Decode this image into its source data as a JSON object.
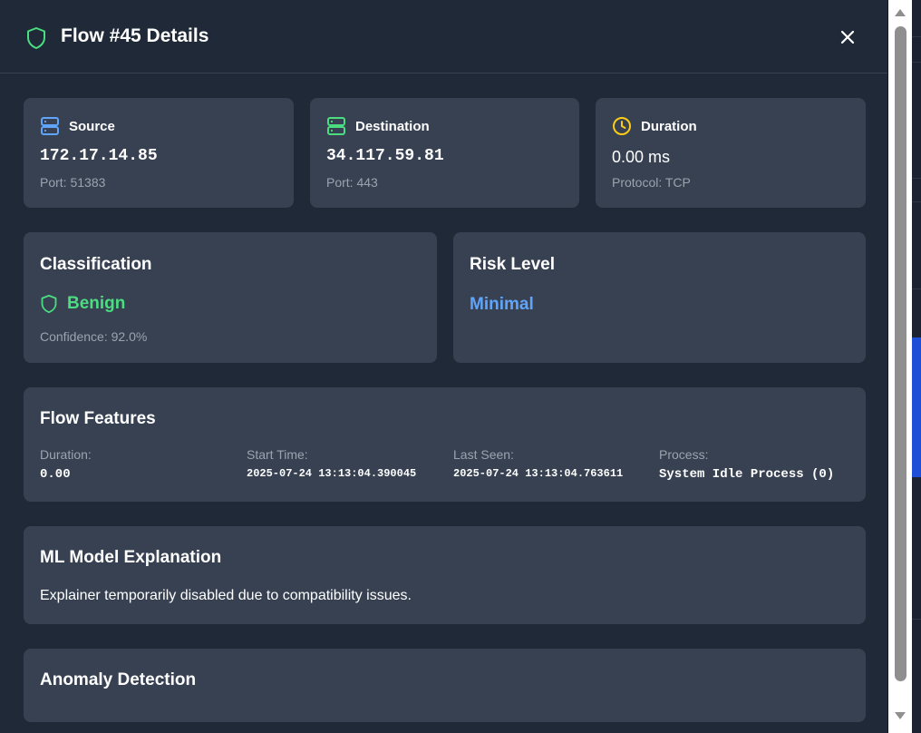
{
  "modal": {
    "title": "Flow #45 Details",
    "close_label": "×"
  },
  "source": {
    "label": "Source",
    "ip": "172.17.14.85",
    "port": "Port: 51383"
  },
  "destination": {
    "label": "Destination",
    "ip": "34.117.59.81",
    "port": "Port: 443"
  },
  "duration": {
    "label": "Duration",
    "value": "0.00 ms",
    "protocol": "Protocol: TCP"
  },
  "classification": {
    "title": "Classification",
    "value": "Benign",
    "confidence": "Confidence: 92.0%"
  },
  "risk": {
    "title": "Risk Level",
    "value": "Minimal"
  },
  "features": {
    "title": "Flow Features",
    "items": [
      {
        "label": "Duration:",
        "value": "0.00"
      },
      {
        "label": "Start Time:",
        "value": "2025-07-24 13:13:04.390045"
      },
      {
        "label": "Last Seen:",
        "value": "2025-07-24 13:13:04.763611"
      },
      {
        "label": "Process:",
        "value": "System Idle Process (0)"
      }
    ]
  },
  "ml": {
    "title": "ML Model Explanation",
    "text": "Explainer temporarily disabled due to compatibility issues."
  },
  "anomaly": {
    "title": "Anomaly Detection"
  },
  "colors": {
    "benign": "#4ade80",
    "risk_minimal": "#60a5fa",
    "duration_icon": "#facc15",
    "source_icon": "#60a5fa",
    "destination_icon": "#4ade80"
  }
}
